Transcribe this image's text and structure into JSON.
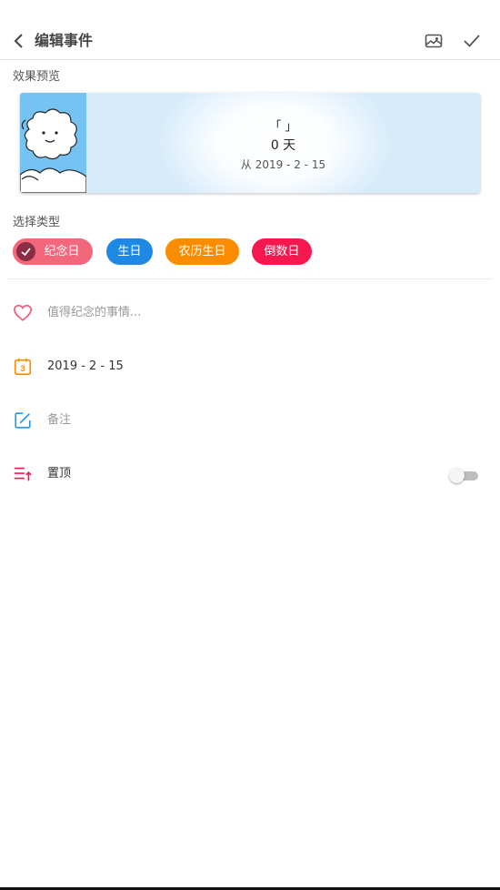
{
  "header": {
    "title": "编辑事件"
  },
  "preview": {
    "section_label": "效果预览",
    "title": "「 」",
    "days": "0 天",
    "from": "从 2019 - 2 - 15"
  },
  "types": {
    "section_label": "选择类型",
    "items": [
      {
        "label": "纪念日",
        "color": "#f4667c",
        "selected": true
      },
      {
        "label": "生日",
        "color": "#1e88e5",
        "selected": false
      },
      {
        "label": "农历生日",
        "color": "#fb8c00",
        "selected": false
      },
      {
        "label": "倒数日",
        "color": "#f5184f",
        "selected": false
      }
    ]
  },
  "form": {
    "event_placeholder": "值得纪念的事情...",
    "date_value": "2019 - 2 - 15",
    "calendar_icon_day": "3",
    "note_placeholder": "备注",
    "pin_label": "置顶",
    "pin_enabled": false
  },
  "colors": {
    "heart": "#f05a78",
    "calendar": "#fb8c00",
    "note": "#2196f3",
    "pin": "#f5184f"
  }
}
